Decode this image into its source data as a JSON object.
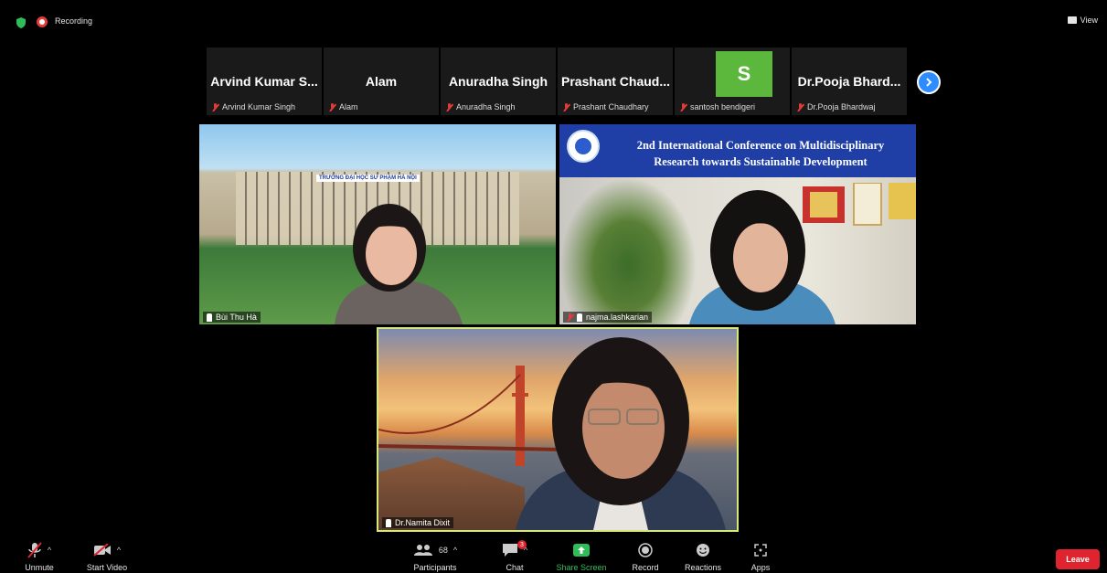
{
  "topbar": {
    "recording_label": "Recording",
    "view_label": "View"
  },
  "strip": [
    {
      "display": "Arvind Kumar S...",
      "name": "Arvind Kumar Singh"
    },
    {
      "display": "Alam",
      "name": "Alam"
    },
    {
      "display": "Anuradha Singh",
      "name": "Anuradha Singh"
    },
    {
      "display": "Prashant Chaud...",
      "name": "Prashant Chaudhary"
    },
    {
      "display": "S",
      "name": "santosh bendigeri",
      "avatar_color": "#5cb83c"
    },
    {
      "display": "Dr.Pooja Bhard...",
      "name": "Dr.Pooja Bhardwaj"
    }
  ],
  "videos": {
    "v1": {
      "name": "Bùi Thu Hà",
      "sign": "TRƯỜNG ĐẠI HỌC SƯ PHẠM HÀ NỘI"
    },
    "v2": {
      "name": "najma.lashkarian",
      "banner_line1": "2nd International Conference on Multidisciplinary",
      "banner_line2": "Research towards Sustainable Development"
    },
    "v3": {
      "name": "Dr.Namita Dixit"
    }
  },
  "toolbar": {
    "unmute": "Unmute",
    "start_video": "Start Video",
    "participants": "Participants",
    "participants_count": "68",
    "chat": "Chat",
    "chat_badge": "3",
    "share_screen": "Share Screen",
    "record": "Record",
    "reactions": "Reactions",
    "apps": "Apps",
    "leave": "Leave"
  },
  "colors": {
    "accent": "#2d8cff",
    "leave": "#e0242f",
    "share": "#2fbd59",
    "active_speaker_border": "#d6e87a"
  }
}
